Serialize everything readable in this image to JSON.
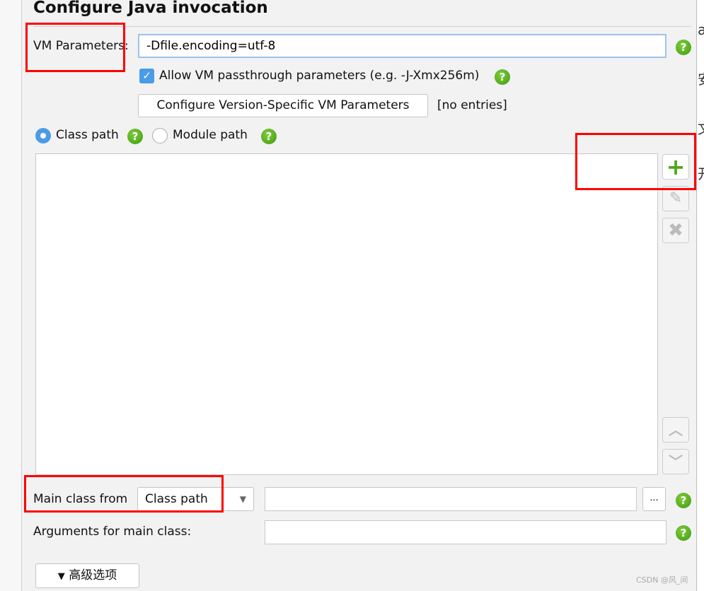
{
  "title": "Configure Java invocation",
  "vm_params": {
    "label": "VM Parameters:",
    "value": "-Dfile.encoding=utf-8"
  },
  "passthrough": {
    "label": "Allow VM passthrough parameters (e.g. -J-Xmx256m)",
    "checked": true
  },
  "version_specific": {
    "button": "Configure Version-Specific VM Parameters",
    "status": "[no entries]"
  },
  "path_mode": {
    "options": [
      "Class path",
      "Module path"
    ],
    "selected": "Class path"
  },
  "list_buttons": {
    "add": "plus-icon",
    "edit": "edit-icon",
    "remove": "remove-icon",
    "up": "chevron-up-icon",
    "down": "chevron-down-icon"
  },
  "main_class": {
    "label": "Main class from",
    "selected": "Class path",
    "value": "",
    "browse": "..."
  },
  "arguments": {
    "label": "Arguments for main class:",
    "value": ""
  },
  "advanced": {
    "label": "高级选项"
  },
  "watermark": "CSDN @风_间",
  "right_edge_chars": [
    "a",
    "安",
    "文",
    "开"
  ],
  "colors": {
    "accent": "#4a9be8",
    "help": "#5aae1e",
    "highlight": "#ff0000"
  }
}
